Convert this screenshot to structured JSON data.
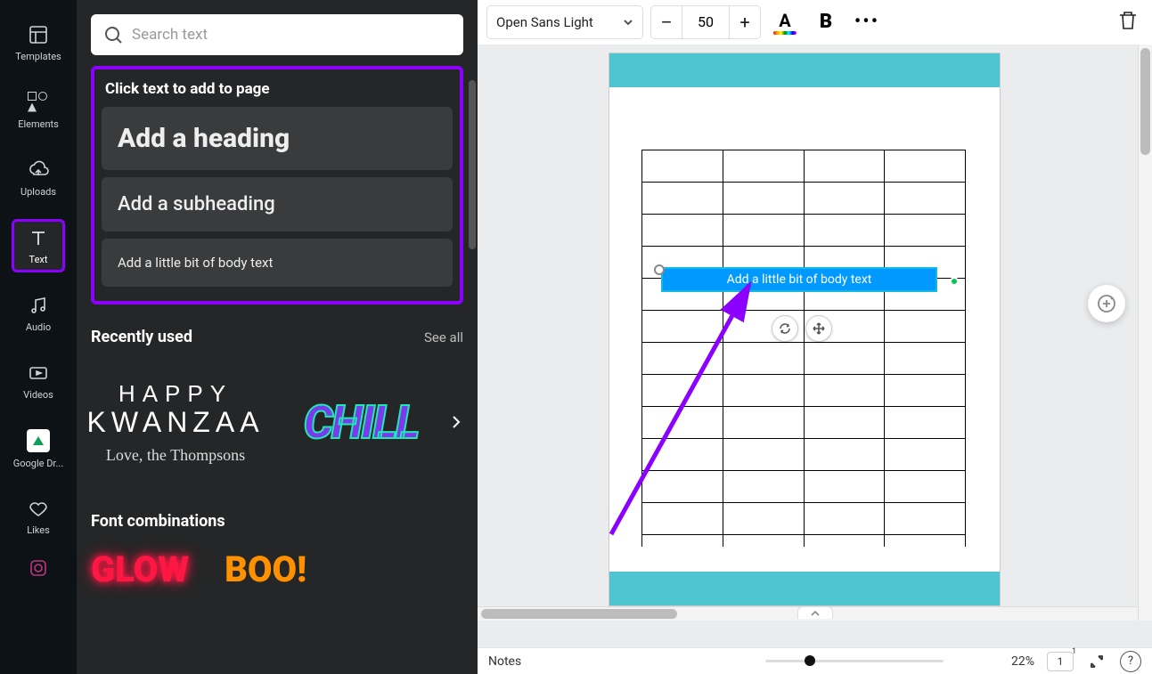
{
  "iconbar": {
    "items": [
      {
        "label": "Templates"
      },
      {
        "label": "Elements"
      },
      {
        "label": "Uploads"
      },
      {
        "label": "Text"
      },
      {
        "label": "Audio"
      },
      {
        "label": "Videos"
      },
      {
        "label": "Google Dr..."
      },
      {
        "label": "Likes"
      }
    ]
  },
  "textpanel": {
    "search_placeholder": "Search text",
    "add_header": "Click text to add to page",
    "add_heading": "Add a heading",
    "add_subheading": "Add a subheading",
    "add_body": "Add a little bit of body text",
    "recently_used": "Recently used",
    "see_all": "See all",
    "recent": {
      "kwanzaa_l1": "HAPPY",
      "kwanzaa_l2": "KWANZAA",
      "kwanzaa_l3": "Love, the Thompsons",
      "chill": "CHILL"
    },
    "font_combinations": "Font combinations",
    "combo_glow": "GLOW",
    "combo_boo": "BOO!"
  },
  "toolbar": {
    "font_name": "Open Sans Light",
    "size_minus": "–",
    "size_value": "50",
    "size_plus": "+",
    "color_A": "A",
    "bold": "B",
    "more": "•••"
  },
  "canvas": {
    "textbox_content": "Add a little bit of body text"
  },
  "bottombar": {
    "notes": "Notes",
    "zoom": "22%",
    "page": "1",
    "help": "?"
  }
}
